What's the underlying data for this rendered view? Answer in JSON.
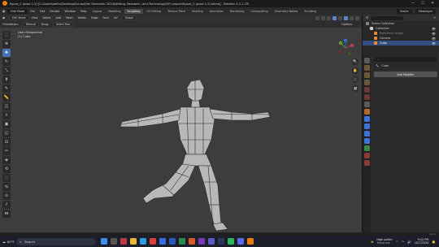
{
  "window": {
    "title": "figure_2 (pose 1.2) [C:\\Users\\bethv\\Desktop\\School\\Fall Semester 2024\\Writing, Research, and Technology\\DIY project\\figure_2 (pose 1.2).blend] - Blender 4.2.1 LTS",
    "controls": [
      "—",
      "☐",
      "✕"
    ]
  },
  "menubar": {
    "editor_icon": "▣",
    "mode": "Edit Mode",
    "items": [
      "File",
      "Edit",
      "Render",
      "Window",
      "Help"
    ],
    "workspaces": [
      "Layout",
      "Modeling",
      "Sculpting",
      "UV Editing",
      "Texture Paint",
      "Shading",
      "Animation",
      "Rendering",
      "Compositing",
      "Geometry Nodes",
      "Scripting"
    ],
    "active_workspace": "Sculpting",
    "scene": "Scene",
    "view_layer": "ViewLayer"
  },
  "header3d": {
    "mode": "Edit Mode",
    "menus": [
      "View",
      "Select",
      "Add",
      "Mesh",
      "Vertex",
      "Edge",
      "Face",
      "UV"
    ],
    "transform": "Global"
  },
  "toolheader": {
    "orientation_label": "Orientation:",
    "orientation_value": "Default",
    "drag_label": "Drag:",
    "drag_value": "Select Box",
    "options": "Options"
  },
  "viewport": {
    "view_name": "User Perspective",
    "object_name": "(1) Cube"
  },
  "toolbar_icons": [
    "select-box-icon",
    "cursor-icon",
    "move-icon",
    "rotate-icon",
    "scale-icon",
    "transform-icon",
    "annotate-icon",
    "measure-icon",
    "add-cube-icon",
    "extrude-icon",
    "inset-icon",
    "bevel-icon",
    "loop-cut-icon",
    "knife-icon",
    "poly-build-icon",
    "spin-icon",
    "smooth-icon",
    "edge-slide-icon",
    "shrink-icon",
    "shear-icon",
    "rip-icon"
  ],
  "toolbar_glyphs": [
    "⬚",
    "⊕",
    "✥",
    "↻",
    "⤡",
    "⬍",
    "✎",
    "📏",
    "◫",
    "⇧",
    "▣",
    "◱",
    "⊟",
    "✂",
    "◈",
    "⟲",
    "◌",
    "⇆",
    "⊙",
    "⫽",
    "⋈"
  ],
  "gizmo": {
    "x": "X",
    "y": "Y",
    "z": "Z"
  },
  "nav_buttons": [
    "🔍",
    "✋",
    "🎥",
    "▦"
  ],
  "outliner": {
    "search_placeholder": "",
    "rows": [
      {
        "label": "Scene Collection",
        "indent": 0,
        "color": "#cfcfcf"
      },
      {
        "label": "Collection",
        "indent": 1,
        "color": "#cfcfcf"
      },
      {
        "label": "Reference Image",
        "indent": 2,
        "color": "#8a8a8a"
      },
      {
        "label": "Camera",
        "indent": 2,
        "color": "#cfcfcf"
      },
      {
        "label": "Cube",
        "indent": 2,
        "color": "#ffffff",
        "selected": true
      }
    ]
  },
  "properties": {
    "search_placeholder": "",
    "object_name": "Cube",
    "add_modifier": "Add Modifier"
  },
  "timeline": {
    "version": "4.2.1"
  },
  "taskbar": {
    "weather_temp": "62°F",
    "search_placeholder": "Search",
    "tray_weather_title": "High pollen",
    "tray_weather_sub": "Tomorrow",
    "time": "9:42 PM",
    "date": "10/7/2024"
  },
  "colors": {
    "accent": "#4772b3",
    "selection": "#334d80",
    "mesh": "#bdbdbd"
  }
}
